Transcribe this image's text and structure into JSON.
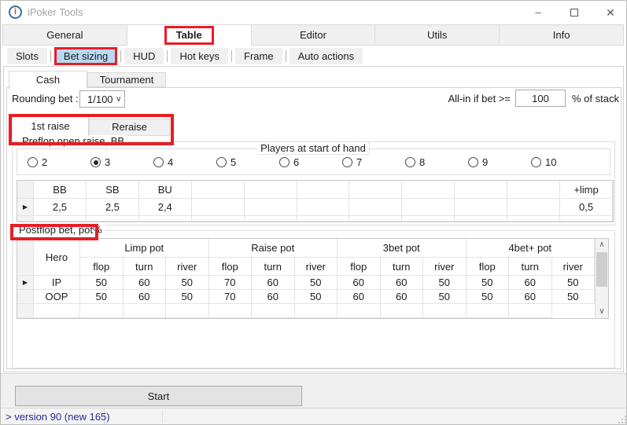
{
  "window": {
    "title": "iPoker Tools"
  },
  "icons": {
    "app": "i",
    "minimize": "–",
    "close": "✕",
    "dropdown": "∨",
    "row_arrow": "▶",
    "scroll_up": "∧",
    "scroll_down": "∨"
  },
  "main_tabs": {
    "items": [
      {
        "label": "General"
      },
      {
        "label": "Table"
      },
      {
        "label": "Editor"
      },
      {
        "label": "Utils"
      },
      {
        "label": "Info"
      }
    ],
    "selected": "Table"
  },
  "sub_tabs": {
    "items": [
      {
        "label": "Slots"
      },
      {
        "label": "Bet sizing"
      },
      {
        "label": "HUD"
      },
      {
        "label": "Hot keys"
      },
      {
        "label": "Frame"
      },
      {
        "label": "Auto actions"
      }
    ],
    "selected": "Bet sizing"
  },
  "mode_tabs": {
    "items": [
      "Cash",
      "Tournament"
    ],
    "selected": "Cash"
  },
  "rounding_bet": {
    "label": "Rounding bet :",
    "value": "1/100"
  },
  "all_in": {
    "label": "All-in if bet >=",
    "value": "100",
    "suffix": "% of stack"
  },
  "raise_tabs": {
    "items": [
      "1st raise",
      "Reraise"
    ],
    "selected": "1st raise"
  },
  "preflop": {
    "group_title": "Preflop open raise, BB",
    "players_title": "Players at start of hand",
    "players": [
      "2",
      "3",
      "4",
      "5",
      "6",
      "7",
      "8",
      "9",
      "10"
    ],
    "selected_player": "3",
    "grid": {
      "headers": [
        "BB",
        "SB",
        "BU",
        "",
        "",
        "",
        "",
        "",
        "",
        "",
        "+limp"
      ],
      "row": [
        "2,5",
        "2,5",
        "2,4",
        "",
        "",
        "",
        "",
        "",
        "",
        "",
        "0,5"
      ]
    }
  },
  "postflop": {
    "group_title": "Postflop bet, pot%",
    "grid": {
      "hero_header": "Hero",
      "pot_groups": [
        "Limp pot",
        "Raise pot",
        "3bet pot",
        "4bet+ pot"
      ],
      "streets": [
        "flop",
        "turn",
        "river"
      ],
      "rows": [
        {
          "label": "IP",
          "values": [
            "50",
            "60",
            "50",
            "70",
            "60",
            "50",
            "60",
            "60",
            "50",
            "50",
            "60",
            "50"
          ]
        },
        {
          "label": "OOP",
          "values": [
            "50",
            "60",
            "50",
            "70",
            "60",
            "50",
            "60",
            "60",
            "50",
            "50",
            "60",
            "50"
          ]
        }
      ]
    }
  },
  "start_button": "Start",
  "status_bar": {
    "text": "> version 90 (new 165)"
  },
  "colors": {
    "highlight_red": "#e61e25",
    "subtab_selected_blue": "#b8d9f1",
    "status_text_blue": "#2b2996",
    "tab_gray": "#f0f0f0"
  }
}
